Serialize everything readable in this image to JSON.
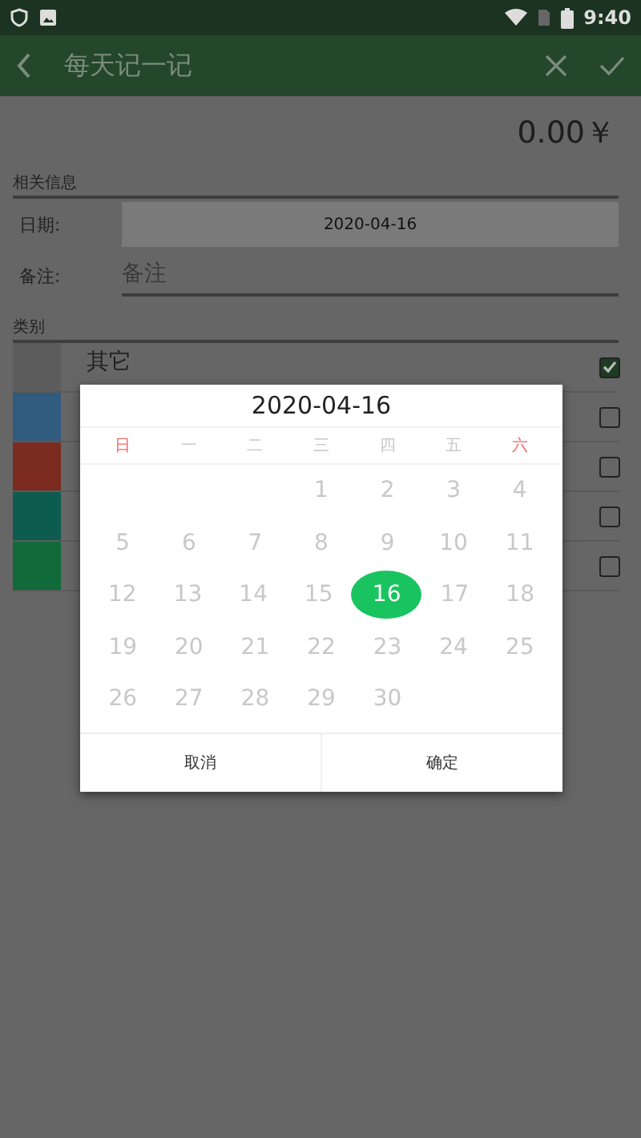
{
  "status_bar": {
    "time": "9:40"
  },
  "toolbar": {
    "title": "每天记一记"
  },
  "amount": "0.00￥",
  "info_section": {
    "title": "相关信息",
    "date_label": "日期:",
    "date_value": "2020-04-16",
    "note_label": "备注:",
    "note_placeholder": "备注"
  },
  "category_section": {
    "title": "类别",
    "items": [
      {
        "name": "其它",
        "color": "#5c5c5c",
        "checked": true
      },
      {
        "color": "#2f5b7e",
        "checked": false
      },
      {
        "color": "#7b2b1f",
        "checked": false
      },
      {
        "color": "#0d5c50",
        "checked": false
      },
      {
        "color": "#106a3a",
        "checked": false
      }
    ]
  },
  "date_dialog": {
    "title": "2020-04-16",
    "weekdays": [
      {
        "label": "日",
        "weekend": true
      },
      {
        "label": "一",
        "weekend": false
      },
      {
        "label": "二",
        "weekend": false
      },
      {
        "label": "三",
        "weekend": false
      },
      {
        "label": "四",
        "weekend": false
      },
      {
        "label": "五",
        "weekend": false
      },
      {
        "label": "六",
        "weekend": true
      }
    ],
    "weeks": [
      [
        {
          "day": "1",
          "selected": false
        },
        {
          "day": "2",
          "selected": false
        },
        {
          "day": "3",
          "selected": false
        },
        {
          "day": "4",
          "selected": false
        }
      ],
      [
        {
          "day": "5",
          "selected": false
        },
        {
          "day": "6",
          "selected": false
        },
        {
          "day": "7",
          "selected": false
        },
        {
          "day": "8",
          "selected": false
        },
        {
          "day": "9",
          "selected": false
        },
        {
          "day": "10",
          "selected": false
        },
        {
          "day": "11",
          "selected": false
        }
      ],
      [
        {
          "day": "12",
          "selected": false
        },
        {
          "day": "13",
          "selected": false
        },
        {
          "day": "14",
          "selected": false
        },
        {
          "day": "15",
          "selected": false
        },
        {
          "day": "16",
          "selected": true
        },
        {
          "day": "17",
          "selected": false
        },
        {
          "day": "18",
          "selected": false
        }
      ],
      [
        {
          "day": "19",
          "selected": false
        },
        {
          "day": "20",
          "selected": false
        },
        {
          "day": "21",
          "selected": false
        },
        {
          "day": "22",
          "selected": false
        },
        {
          "day": "23",
          "selected": false
        },
        {
          "day": "24",
          "selected": false
        },
        {
          "day": "25",
          "selected": false
        }
      ],
      [
        {
          "day": "26",
          "selected": false
        },
        {
          "day": "27",
          "selected": false
        },
        {
          "day": "28",
          "selected": false
        },
        {
          "day": "29",
          "selected": false
        },
        {
          "day": "30",
          "selected": false
        }
      ]
    ],
    "buttons": [
      "取消",
      "确定"
    ]
  }
}
